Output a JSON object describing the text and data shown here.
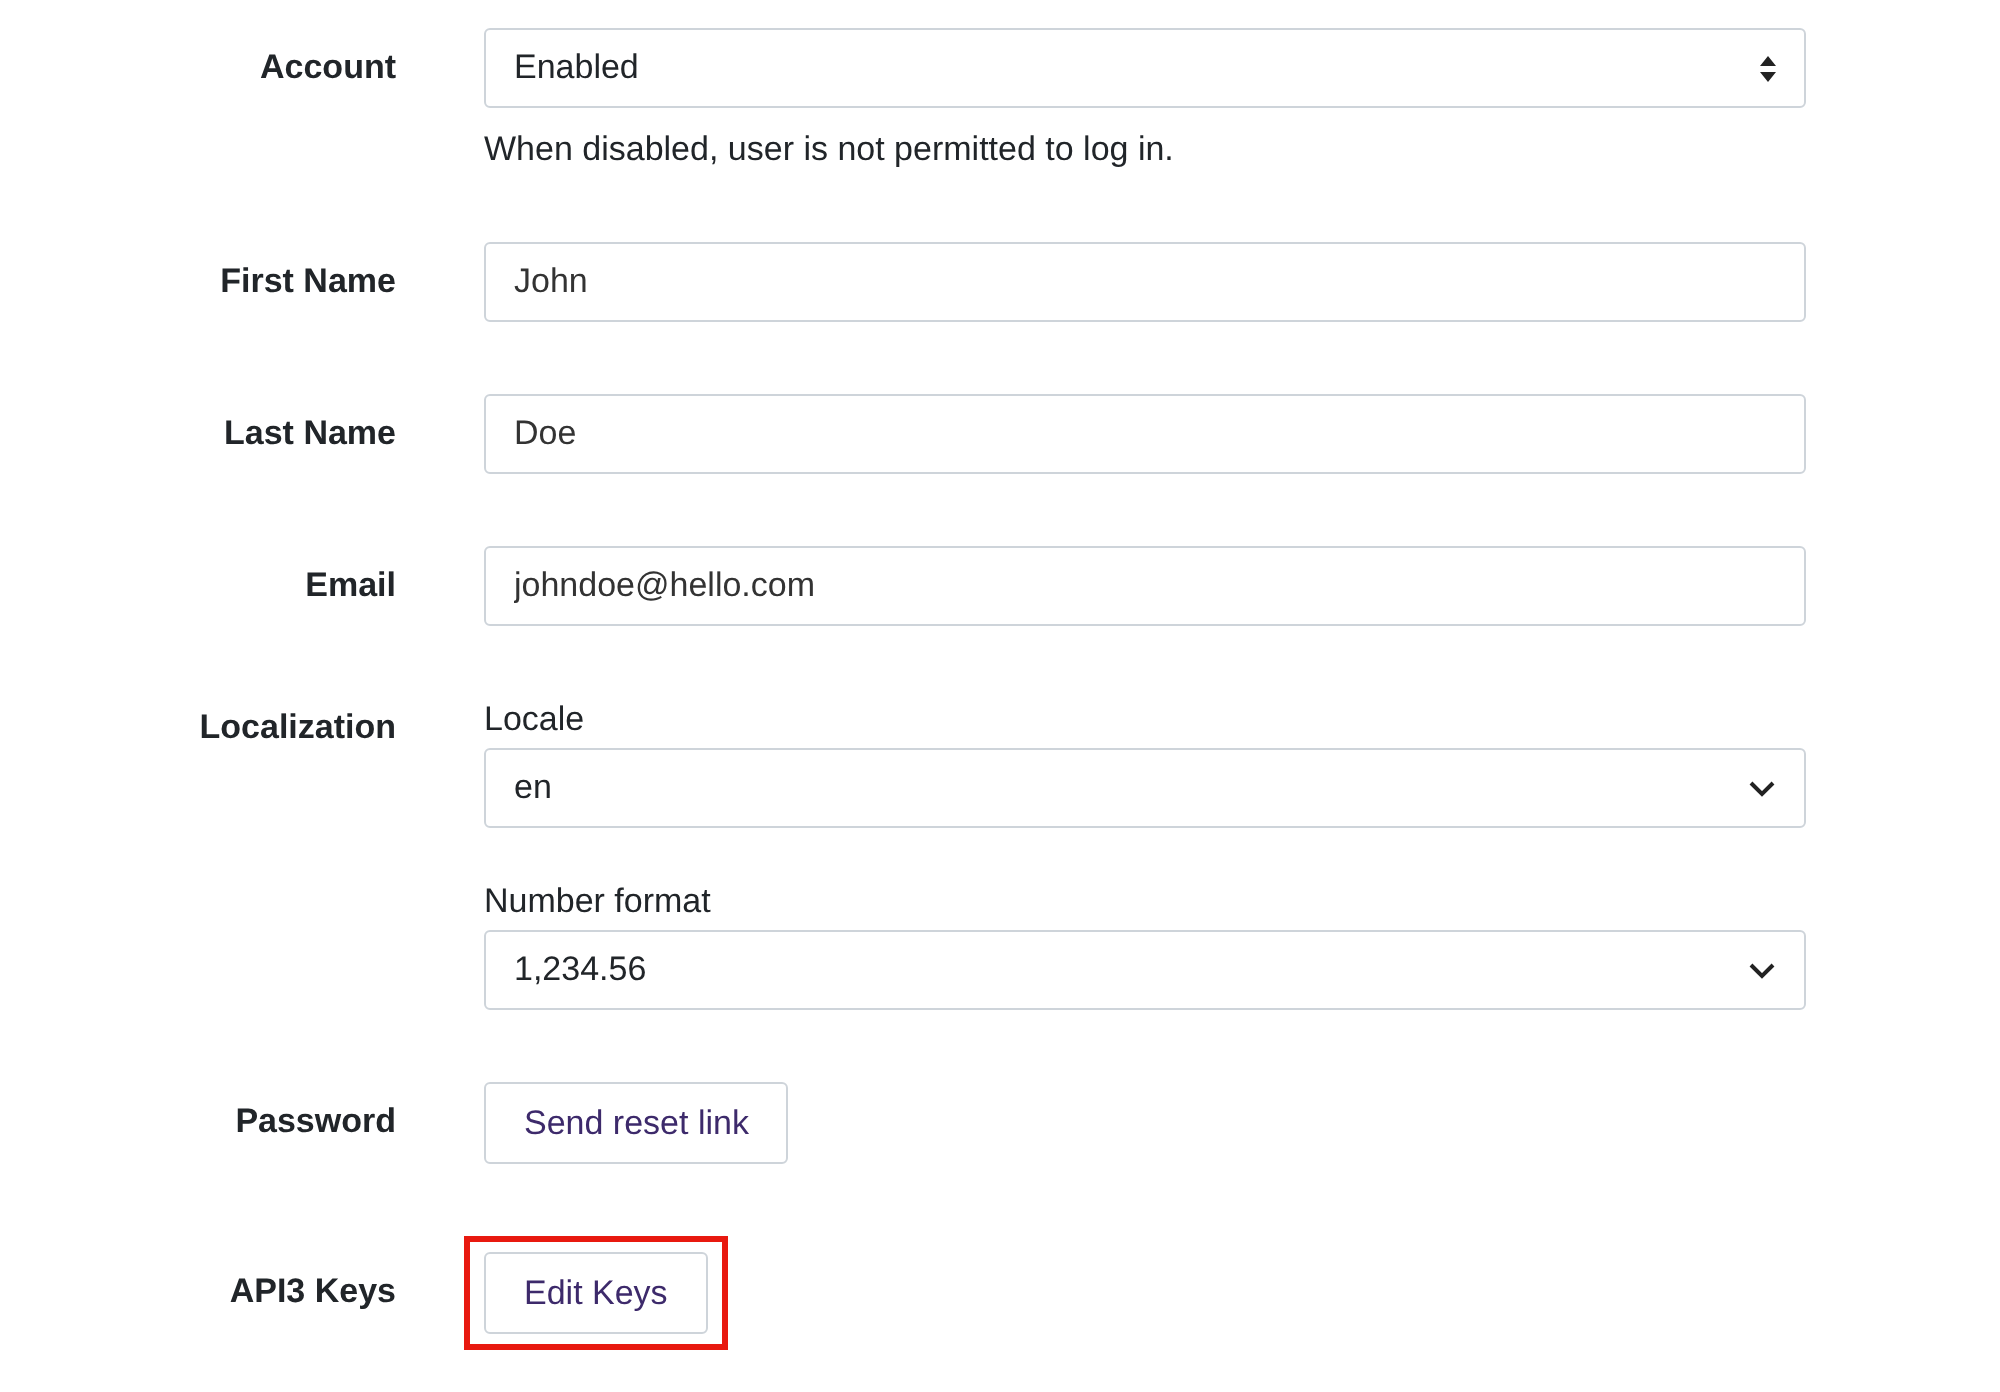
{
  "rows": [
    {
      "kind": "select",
      "label": "Account",
      "value": "Enabled",
      "help": "When disabled, user is not permitted to log in."
    },
    {
      "kind": "text",
      "label": "First Name",
      "value": "John"
    },
    {
      "kind": "text",
      "label": "Last Name",
      "value": "Doe"
    },
    {
      "kind": "text",
      "label": "Email",
      "value": "johndoe@hello.com"
    },
    {
      "kind": "group",
      "label": "Localization",
      "subfields": [
        {
          "label": "Locale",
          "value": "en"
        },
        {
          "label": "Number format",
          "value": "1,234.56"
        }
      ]
    },
    {
      "kind": "button",
      "label": "Password",
      "button": "Send reset link",
      "highlighted": false
    },
    {
      "kind": "button",
      "label": "API3 Keys",
      "button": "Edit Keys",
      "highlighted": true
    }
  ]
}
